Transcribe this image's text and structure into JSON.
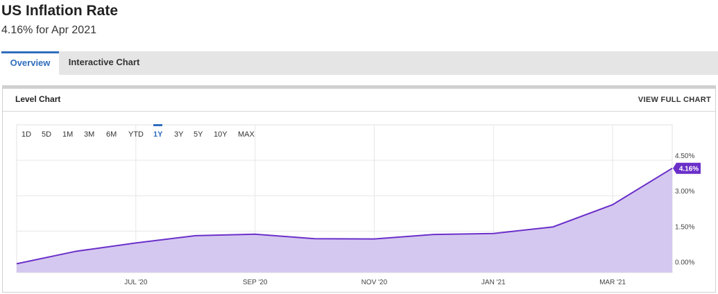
{
  "header": {
    "title": "US Inflation Rate",
    "subtitle": "4.16% for Apr 2021"
  },
  "tabs": [
    {
      "label": "Overview",
      "active": true
    },
    {
      "label": "Interactive Chart",
      "active": false
    }
  ],
  "panel": {
    "title": "Level Chart",
    "view_full_label": "VIEW FULL CHART"
  },
  "ranges": [
    {
      "label": "1D",
      "active": false
    },
    {
      "label": "5D",
      "active": false
    },
    {
      "label": "1M",
      "active": false
    },
    {
      "label": "3M",
      "active": false
    },
    {
      "label": "6M",
      "active": false
    },
    {
      "label": "YTD",
      "active": false
    },
    {
      "label": "1Y",
      "active": true
    },
    {
      "label": "3Y",
      "active": false
    },
    {
      "label": "5Y",
      "active": false
    },
    {
      "label": "10Y",
      "active": false
    },
    {
      "label": "MAX",
      "active": false
    }
  ],
  "colors": {
    "accent": "#2f6dbd",
    "line": "#6a2fc9",
    "fill": "#d5c8f0",
    "badge": "#6a2fc9"
  },
  "chart_data": {
    "type": "area",
    "title": "",
    "xlabel": "",
    "ylabel": "",
    "x": [
      "May 2020",
      "Jun 2020",
      "Jul 2020",
      "Aug 2020",
      "Sep 2020",
      "Oct 2020",
      "Nov 2020",
      "Dec 2020",
      "Jan 2021",
      "Feb 2021",
      "Mar 2021",
      "Apr 2021"
    ],
    "series": [
      {
        "name": "",
        "values": [
          0.12,
          0.65,
          1.0,
          1.31,
          1.37,
          1.18,
          1.17,
          1.36,
          1.4,
          1.68,
          2.62,
          4.16
        ]
      }
    ],
    "x_ticks": [
      "JUL '20",
      "SEP '20",
      "NOV '20",
      "JAN '21",
      "MAR '21"
    ],
    "y_ticks": [
      "0.00%",
      "1.50%",
      "3.00%",
      "4.50%"
    ],
    "y_tick_values": [
      0,
      1.5,
      3.0,
      4.5
    ],
    "ylim": [
      -0.25,
      6.0
    ],
    "last_value_label": "4.16%",
    "grid": true
  }
}
